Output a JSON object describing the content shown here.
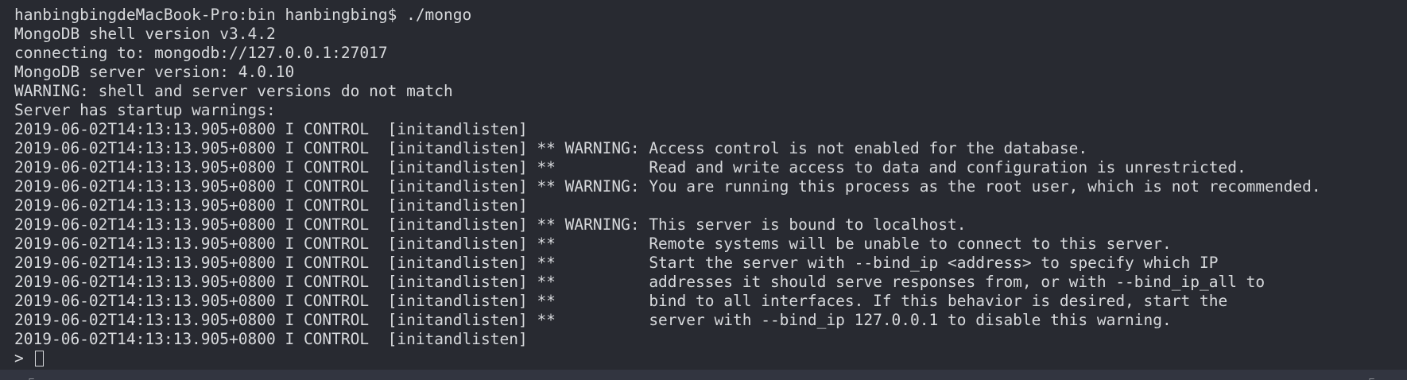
{
  "terminal": {
    "lines": [
      "hanbingbingdeMacBook-Pro:bin hanbingbing$ ./mongo",
      "MongoDB shell version v3.4.2",
      "connecting to: mongodb://127.0.0.1:27017",
      "MongoDB server version: 4.0.10",
      "WARNING: shell and server versions do not match",
      "Server has startup warnings:",
      "2019-06-02T14:13:13.905+0800 I CONTROL  [initandlisten]",
      "2019-06-02T14:13:13.905+0800 I CONTROL  [initandlisten] ** WARNING: Access control is not enabled for the database.",
      "2019-06-02T14:13:13.905+0800 I CONTROL  [initandlisten] **          Read and write access to data and configuration is unrestricted.",
      "2019-06-02T14:13:13.905+0800 I CONTROL  [initandlisten] ** WARNING: You are running this process as the root user, which is not recommended.",
      "2019-06-02T14:13:13.905+0800 I CONTROL  [initandlisten]",
      "2019-06-02T14:13:13.905+0800 I CONTROL  [initandlisten] ** WARNING: This server is bound to localhost.",
      "2019-06-02T14:13:13.905+0800 I CONTROL  [initandlisten] **          Remote systems will be unable to connect to this server.",
      "2019-06-02T14:13:13.905+0800 I CONTROL  [initandlisten] **          Start the server with --bind_ip <address> to specify which IP",
      "2019-06-02T14:13:13.905+0800 I CONTROL  [initandlisten] **          addresses it should serve responses from, or with --bind_ip_all to",
      "2019-06-02T14:13:13.905+0800 I CONTROL  [initandlisten] **          bind to all interfaces. If this behavior is desired, start the",
      "2019-06-02T14:13:13.905+0800 I CONTROL  [initandlisten] **          server with --bind_ip 127.0.0.1 to disable this warning.",
      "2019-06-02T14:13:13.905+0800 I CONTROL  [initandlisten]"
    ],
    "prompt": ">"
  },
  "colors": {
    "background": "#282a31",
    "foreground": "#d7d9dc"
  }
}
